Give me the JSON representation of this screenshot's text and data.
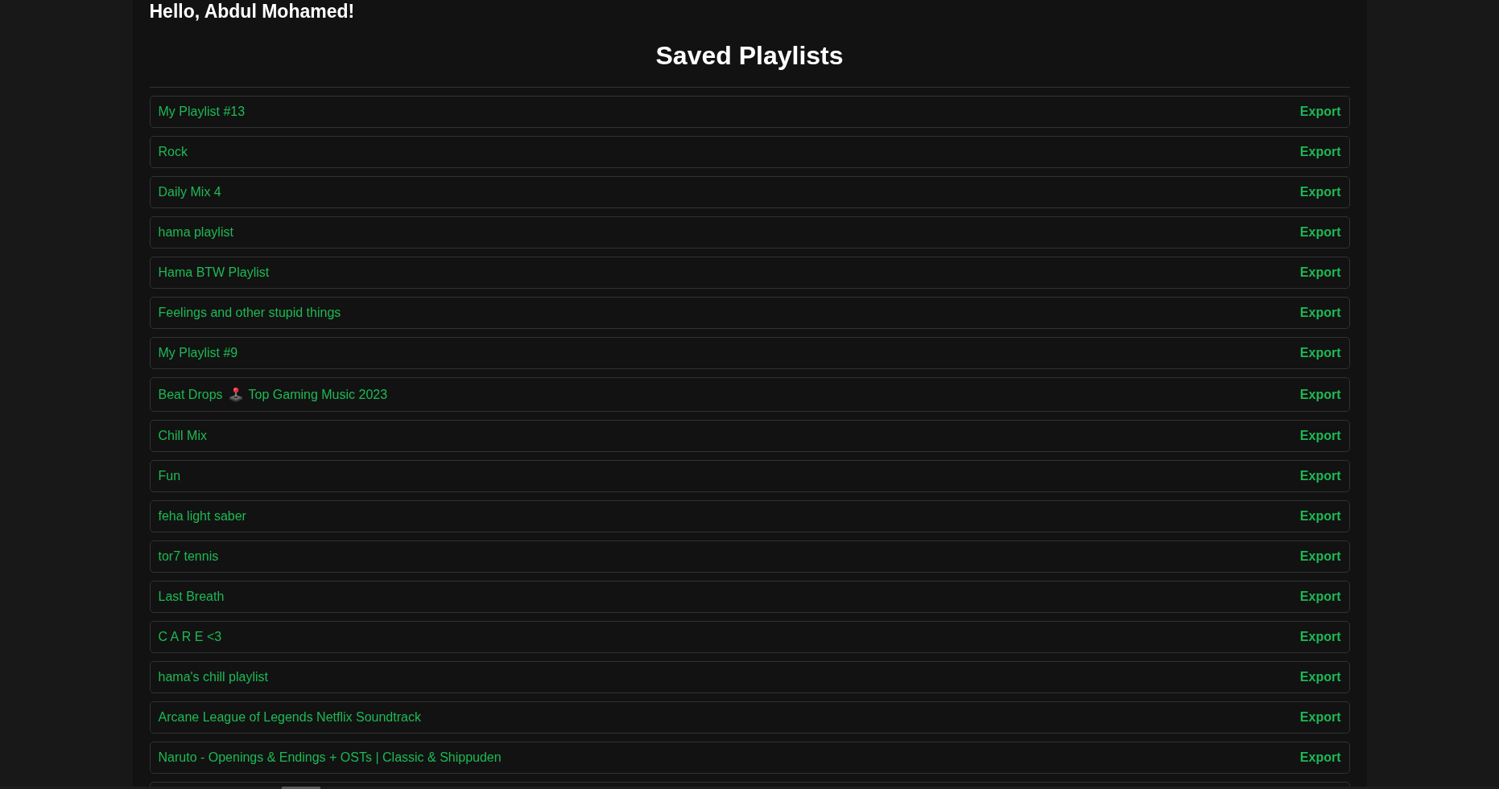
{
  "greeting": "Hello, Abdul Mohamed!",
  "title": "Saved Playlists",
  "playlists": [
    {
      "kind": "plain",
      "name": "My Playlist #13",
      "action": "Export"
    },
    {
      "kind": "plain",
      "name": "Rock",
      "action": "Export"
    },
    {
      "kind": "plain",
      "name": "Daily Mix 4",
      "action": "Export"
    },
    {
      "kind": "plain",
      "name": "hama playlist",
      "action": "Export"
    },
    {
      "kind": "plain",
      "name": "Hama BTW Playlist",
      "action": "Export"
    },
    {
      "kind": "plain",
      "name": "Feelings and other stupid things",
      "action": "Export"
    },
    {
      "kind": "plain",
      "name": "My Playlist #9",
      "action": "Export"
    },
    {
      "kind": "split",
      "name": "Beat Drops",
      "name_after": "Top Gaming Music 2023",
      "action": "Export"
    },
    {
      "kind": "plain",
      "name": "Chill Mix",
      "action": "Export"
    },
    {
      "kind": "plain",
      "name": "Fun",
      "action": "Export"
    },
    {
      "kind": "plain",
      "name": "feha light saber",
      "action": "Export"
    },
    {
      "kind": "plain",
      "name": "tor7 tennis",
      "action": "Export"
    },
    {
      "kind": "plain",
      "name": "Last Breath",
      "action": "Export"
    },
    {
      "kind": "plain",
      "name": "C A R E <3",
      "action": "Export"
    },
    {
      "kind": "plain",
      "name": "hama's chill playlist",
      "action": "Export"
    },
    {
      "kind": "plain",
      "name": "Arcane League of Legends Netflix Soundtrack",
      "action": "Export"
    },
    {
      "kind": "plain",
      "name": "Naruto - Openings & Endings + OSTs | Classic & Shippuden",
      "action": "Export"
    }
  ],
  "list_continues": true
}
